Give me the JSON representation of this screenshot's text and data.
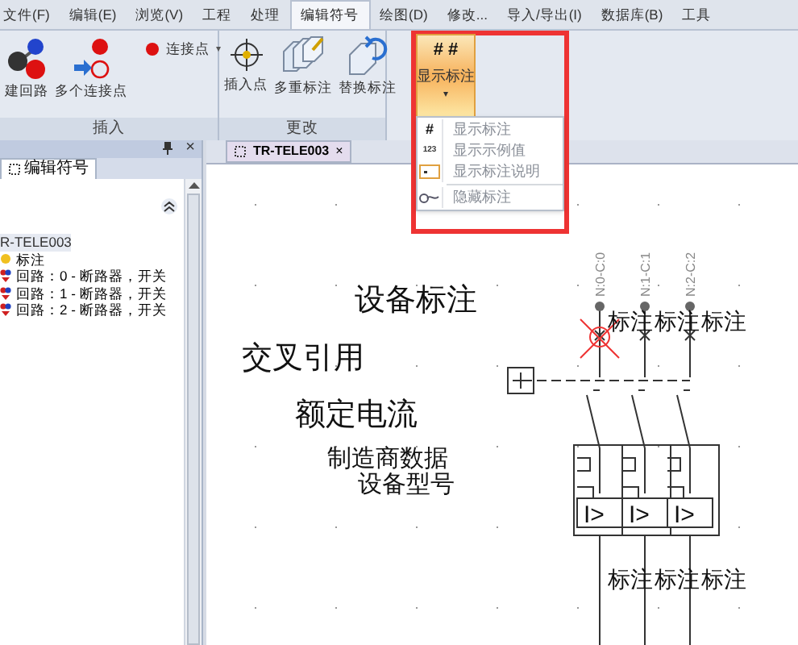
{
  "menu_tabs": [
    {
      "label": "文件(F)",
      "selected": false
    },
    {
      "label": "编辑(E)",
      "selected": false
    },
    {
      "label": "浏览(V)",
      "selected": false
    },
    {
      "label": "工程",
      "selected": false
    },
    {
      "label": "处理",
      "selected": false
    },
    {
      "label": "编辑符号",
      "selected": true
    },
    {
      "label": "绘图(D)",
      "selected": false
    },
    {
      "label": "修改...",
      "selected": false
    },
    {
      "label": "导入/导出(I)",
      "selected": false
    },
    {
      "label": "数据库(B)",
      "selected": false
    },
    {
      "label": "工具",
      "selected": false
    }
  ],
  "ribbon_groups": [
    {
      "title": "插入",
      "buttons": [
        {
          "kind": "large",
          "label": "建回路"
        },
        {
          "kind": "large",
          "label": "多个连接点"
        },
        {
          "kind": "small",
          "label": "连接点",
          "caret": "▾"
        }
      ]
    },
    {
      "title": "更改",
      "buttons": [
        {
          "kind": "large",
          "label": "插入点"
        },
        {
          "kind": "large",
          "label": "多重标注"
        },
        {
          "kind": "large",
          "label": "替换标注"
        }
      ]
    }
  ],
  "show_button": {
    "glyph": "# #",
    "label": "显示标注",
    "caret": "▾",
    "pressed": true
  },
  "dropdown_items": [
    {
      "glyph": "#",
      "label": "显示标注",
      "separator_before": false
    },
    {
      "glyph": "123",
      "label": "显示示例值",
      "separator_before": false
    },
    {
      "label": "显示标注说明",
      "separator_before": false
    },
    {
      "label": "隐藏标注",
      "separator_before": true
    }
  ],
  "panel": {
    "close": "×",
    "tab": "编辑符号",
    "tree": {
      "label": "R-TELE003",
      "selected": true,
      "children": [
        {
          "label": "标注",
          "selected": false
        },
        {
          "label": "回路：0 - 断路器，开关",
          "selected": false
        },
        {
          "label": "回路：1 - 断路器，开关",
          "selected": false
        },
        {
          "label": "回路：2 - 断路器，开关",
          "selected": false
        }
      ]
    }
  },
  "document_tab": {
    "label": "TR-TELE003",
    "close": "×"
  },
  "canvas_labels": [
    "设备标注",
    "交叉引用",
    "额定电流",
    "制造商数据",
    "设备型号"
  ],
  "schematic": {
    "pole_labels": [
      "N:0-C:0",
      "N:1-C:1",
      "N:2-C:2"
    ],
    "top_annotations": [
      "标注",
      "标注",
      "标注"
    ],
    "trip_labels": [
      "I>",
      "I>",
      "I>"
    ],
    "bottom_annotations": [
      "标注",
      "标注",
      "标注"
    ]
  }
}
